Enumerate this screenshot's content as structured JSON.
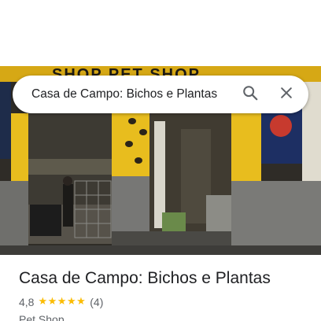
{
  "search": {
    "query": "Casa de Campo: Bichos e Plantas"
  },
  "photo": {
    "sign_text": "SHOP PET SHOP"
  },
  "place": {
    "title": "Casa de Campo: Bichos e Plantas",
    "rating": "4,8",
    "stars": 5,
    "review_count": "(4)",
    "category": "Pet Shop"
  },
  "icons": {
    "search": "search-icon",
    "close": "close-icon",
    "star": "star-icon"
  },
  "colors": {
    "star": "#fbbc04",
    "text_primary": "#202124",
    "text_secondary": "#5f6368",
    "storefront_yellow": "#e8bd1e"
  }
}
